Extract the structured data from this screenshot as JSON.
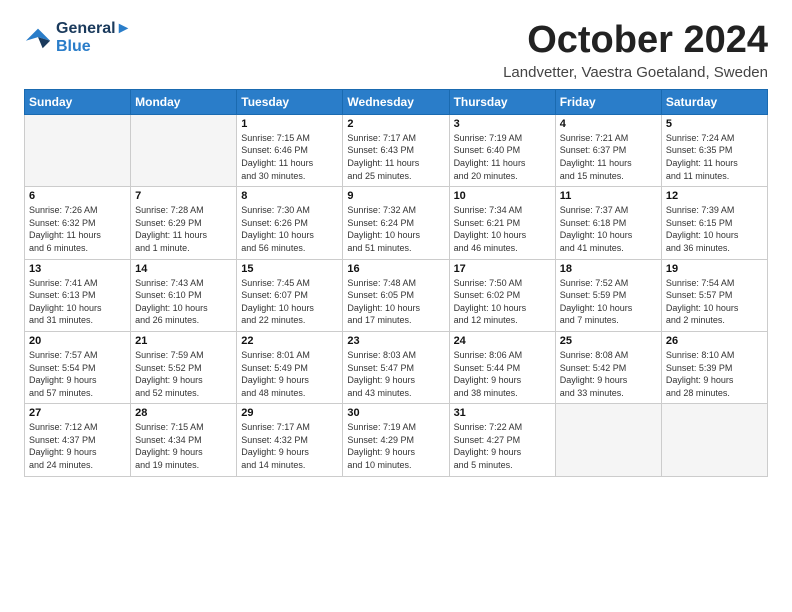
{
  "logo": {
    "line1": "General",
    "line2": "Blue"
  },
  "title": "October 2024",
  "location": "Landvetter, Vaestra Goetaland, Sweden",
  "days_header": [
    "Sunday",
    "Monday",
    "Tuesday",
    "Wednesday",
    "Thursday",
    "Friday",
    "Saturday"
  ],
  "weeks": [
    [
      {
        "day": "",
        "info": ""
      },
      {
        "day": "",
        "info": ""
      },
      {
        "day": "1",
        "info": "Sunrise: 7:15 AM\nSunset: 6:46 PM\nDaylight: 11 hours\nand 30 minutes."
      },
      {
        "day": "2",
        "info": "Sunrise: 7:17 AM\nSunset: 6:43 PM\nDaylight: 11 hours\nand 25 minutes."
      },
      {
        "day": "3",
        "info": "Sunrise: 7:19 AM\nSunset: 6:40 PM\nDaylight: 11 hours\nand 20 minutes."
      },
      {
        "day": "4",
        "info": "Sunrise: 7:21 AM\nSunset: 6:37 PM\nDaylight: 11 hours\nand 15 minutes."
      },
      {
        "day": "5",
        "info": "Sunrise: 7:24 AM\nSunset: 6:35 PM\nDaylight: 11 hours\nand 11 minutes."
      }
    ],
    [
      {
        "day": "6",
        "info": "Sunrise: 7:26 AM\nSunset: 6:32 PM\nDaylight: 11 hours\nand 6 minutes."
      },
      {
        "day": "7",
        "info": "Sunrise: 7:28 AM\nSunset: 6:29 PM\nDaylight: 11 hours\nand 1 minute."
      },
      {
        "day": "8",
        "info": "Sunrise: 7:30 AM\nSunset: 6:26 PM\nDaylight: 10 hours\nand 56 minutes."
      },
      {
        "day": "9",
        "info": "Sunrise: 7:32 AM\nSunset: 6:24 PM\nDaylight: 10 hours\nand 51 minutes."
      },
      {
        "day": "10",
        "info": "Sunrise: 7:34 AM\nSunset: 6:21 PM\nDaylight: 10 hours\nand 46 minutes."
      },
      {
        "day": "11",
        "info": "Sunrise: 7:37 AM\nSunset: 6:18 PM\nDaylight: 10 hours\nand 41 minutes."
      },
      {
        "day": "12",
        "info": "Sunrise: 7:39 AM\nSunset: 6:15 PM\nDaylight: 10 hours\nand 36 minutes."
      }
    ],
    [
      {
        "day": "13",
        "info": "Sunrise: 7:41 AM\nSunset: 6:13 PM\nDaylight: 10 hours\nand 31 minutes."
      },
      {
        "day": "14",
        "info": "Sunrise: 7:43 AM\nSunset: 6:10 PM\nDaylight: 10 hours\nand 26 minutes."
      },
      {
        "day": "15",
        "info": "Sunrise: 7:45 AM\nSunset: 6:07 PM\nDaylight: 10 hours\nand 22 minutes."
      },
      {
        "day": "16",
        "info": "Sunrise: 7:48 AM\nSunset: 6:05 PM\nDaylight: 10 hours\nand 17 minutes."
      },
      {
        "day": "17",
        "info": "Sunrise: 7:50 AM\nSunset: 6:02 PM\nDaylight: 10 hours\nand 12 minutes."
      },
      {
        "day": "18",
        "info": "Sunrise: 7:52 AM\nSunset: 5:59 PM\nDaylight: 10 hours\nand 7 minutes."
      },
      {
        "day": "19",
        "info": "Sunrise: 7:54 AM\nSunset: 5:57 PM\nDaylight: 10 hours\nand 2 minutes."
      }
    ],
    [
      {
        "day": "20",
        "info": "Sunrise: 7:57 AM\nSunset: 5:54 PM\nDaylight: 9 hours\nand 57 minutes."
      },
      {
        "day": "21",
        "info": "Sunrise: 7:59 AM\nSunset: 5:52 PM\nDaylight: 9 hours\nand 52 minutes."
      },
      {
        "day": "22",
        "info": "Sunrise: 8:01 AM\nSunset: 5:49 PM\nDaylight: 9 hours\nand 48 minutes."
      },
      {
        "day": "23",
        "info": "Sunrise: 8:03 AM\nSunset: 5:47 PM\nDaylight: 9 hours\nand 43 minutes."
      },
      {
        "day": "24",
        "info": "Sunrise: 8:06 AM\nSunset: 5:44 PM\nDaylight: 9 hours\nand 38 minutes."
      },
      {
        "day": "25",
        "info": "Sunrise: 8:08 AM\nSunset: 5:42 PM\nDaylight: 9 hours\nand 33 minutes."
      },
      {
        "day": "26",
        "info": "Sunrise: 8:10 AM\nSunset: 5:39 PM\nDaylight: 9 hours\nand 28 minutes."
      }
    ],
    [
      {
        "day": "27",
        "info": "Sunrise: 7:12 AM\nSunset: 4:37 PM\nDaylight: 9 hours\nand 24 minutes."
      },
      {
        "day": "28",
        "info": "Sunrise: 7:15 AM\nSunset: 4:34 PM\nDaylight: 9 hours\nand 19 minutes."
      },
      {
        "day": "29",
        "info": "Sunrise: 7:17 AM\nSunset: 4:32 PM\nDaylight: 9 hours\nand 14 minutes."
      },
      {
        "day": "30",
        "info": "Sunrise: 7:19 AM\nSunset: 4:29 PM\nDaylight: 9 hours\nand 10 minutes."
      },
      {
        "day": "31",
        "info": "Sunrise: 7:22 AM\nSunset: 4:27 PM\nDaylight: 9 hours\nand 5 minutes."
      },
      {
        "day": "",
        "info": ""
      },
      {
        "day": "",
        "info": ""
      }
    ]
  ]
}
